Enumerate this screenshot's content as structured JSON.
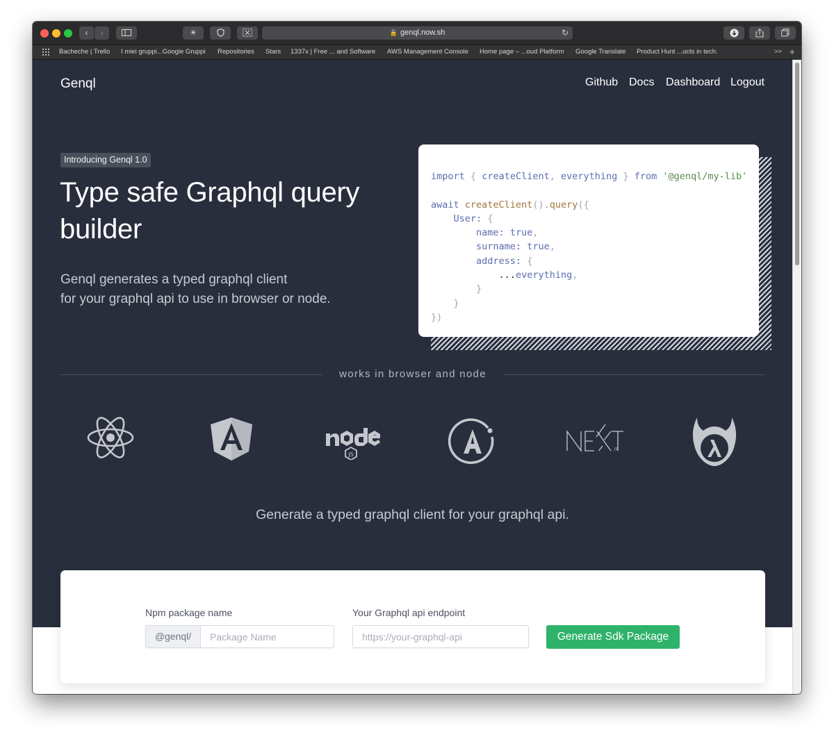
{
  "browser": {
    "url": "genql.now.sh",
    "bookmarks": [
      "Bacheche | Trello",
      "I miei gruppi...Google Gruppi",
      "Repositories",
      "Stars",
      "1337x | Free ... and Software",
      "AWS Management Console",
      "Home page – ...oud Platform",
      "Google Translate",
      "Product Hunt ...ucts in tech."
    ],
    "bookmarks_more": ">>",
    "new_tab": "+"
  },
  "nav": {
    "brand": "Genql",
    "links": [
      "Github",
      "Docs",
      "Dashboard",
      "Logout"
    ]
  },
  "hero": {
    "badge": "Introducing Genql 1.0",
    "title": "Type safe Graphql query builder",
    "subtitle_line1": "Genql generates a typed graphql client",
    "subtitle_line2": "for your graphql api to use in browser or node."
  },
  "code": {
    "line1": {
      "import": "import",
      "lb": "{",
      "a": "createClient",
      "comma": ",",
      "b": "everything",
      "rb": "}",
      "from": "from",
      "str": "'@genql/my-lib'"
    },
    "line2": {
      "await": "await",
      "fn": "createClient",
      "call": "().",
      "query": "query",
      "open": "({"
    },
    "user": "User:",
    "user_open": "{",
    "name": "name:",
    "name_val": "true",
    "surname": "surname:",
    "surname_val": "true",
    "address": "address:",
    "address_open": "{",
    "spread": "...",
    "everything": "everything",
    "close_inner": "}",
    "close_user": "}",
    "close_all": "})"
  },
  "works_in": "works in browser and node",
  "logos": [
    "react-icon",
    "angular-icon",
    "nodejs-icon",
    "apollo-icon",
    "nextjs-icon",
    "hapi-icon"
  ],
  "tagline": "Generate a typed graphql client for your graphql api.",
  "form": {
    "package_label": "Npm package name",
    "package_prefix": "@genql/",
    "package_placeholder": "Package Name",
    "endpoint_label": "Your Graphql api endpoint",
    "endpoint_placeholder": "https://your-graphql-api",
    "submit": "Generate Sdk Package"
  },
  "colors": {
    "hero_bg": "#292e3d",
    "accent_green": "#2fb36a",
    "logo_gray": "#c4c7cc"
  }
}
